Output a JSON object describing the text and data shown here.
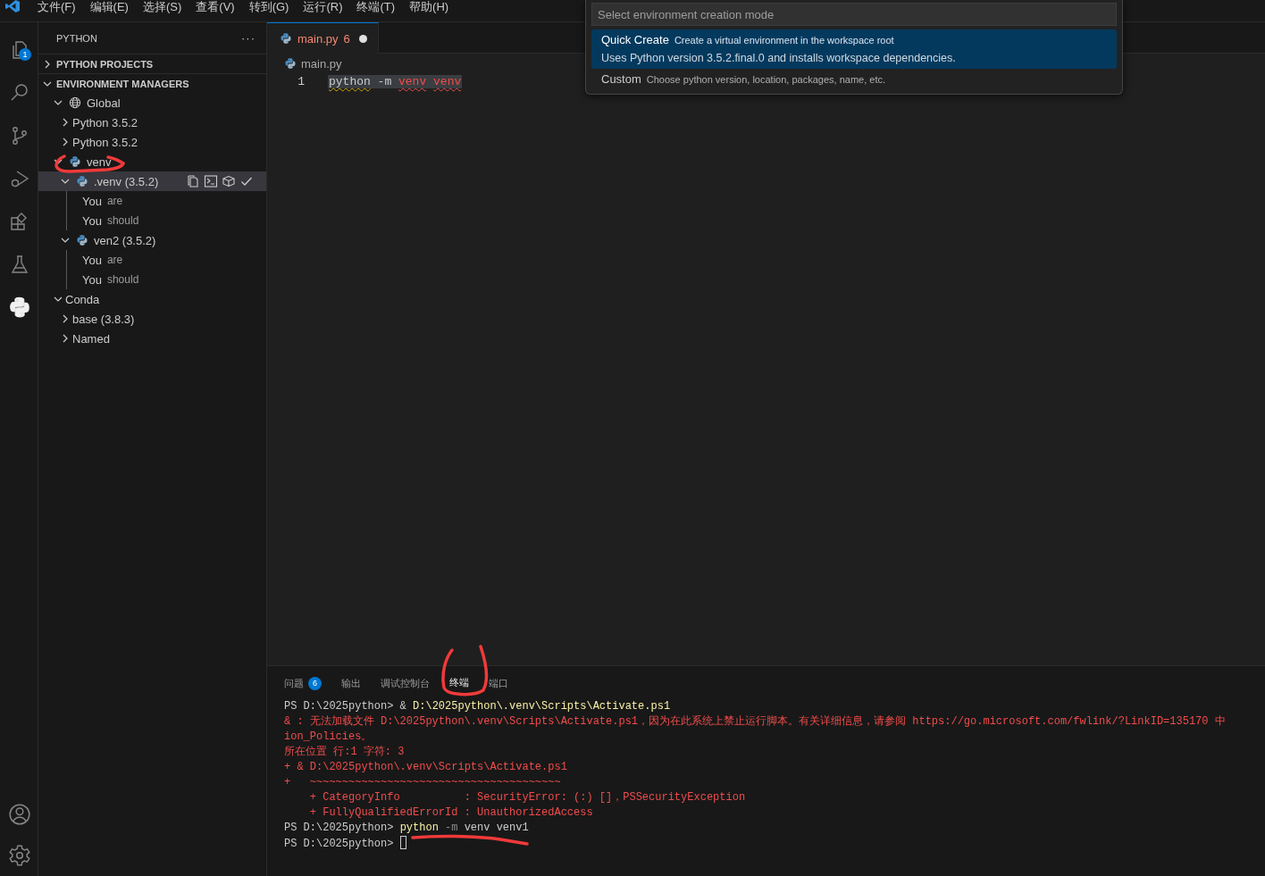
{
  "menu_bar": {
    "items": [
      "文件(F)",
      "编辑(E)",
      "选择(S)",
      "查看(V)",
      "转到(G)",
      "运行(R)",
      "终端(T)",
      "帮助(H)"
    ]
  },
  "activity_bar": {
    "items": [
      {
        "kind": "explorer",
        "selected": false,
        "badge": "1"
      },
      {
        "kind": "search",
        "selected": false
      },
      {
        "kind": "scm",
        "selected": false
      },
      {
        "kind": "debug",
        "selected": false
      },
      {
        "kind": "extensions",
        "selected": false
      },
      {
        "kind": "testing",
        "selected": false
      },
      {
        "kind": "python",
        "selected": true
      }
    ],
    "bottom": [
      {
        "kind": "account"
      },
      {
        "kind": "settings"
      }
    ]
  },
  "sidebar": {
    "title": "PYTHON",
    "more": "···",
    "sections": [
      {
        "title": "PYTHON PROJECTS",
        "expanded": false
      },
      {
        "title": "ENVIRONMENT MANAGERS",
        "expanded": true,
        "tree": [
          {
            "label": "Global",
            "kind": "scope",
            "expanded": true,
            "children": [
              {
                "label": "Python 3.5.2",
                "kind": "plain",
                "expanded": false
              },
              {
                "label": "Python 3.5.2",
                "kind": "plain",
                "expanded": false
              }
            ]
          },
          {
            "label": "venv",
            "kind": "environment",
            "expanded": true,
            "children": [
              {
                "label": ".venv (3.5.2)",
                "kind": "environment",
                "expanded": true,
                "selected": true,
                "children": [
                  {
                    "label": "You",
                    "description": "are"
                  },
                  {
                    "label": "You",
                    "description": "should"
                  }
                ]
              },
              {
                "label": "ven2 (3.5.2)",
                "kind": "environment",
                "expanded": true,
                "selected": false,
                "children": [
                  {
                    "label": "You",
                    "description": "are"
                  },
                  {
                    "label": "You",
                    "description": "should"
                  }
                ]
              }
            ]
          },
          {
            "label": "Conda",
            "kind": "plain",
            "expanded": true,
            "children": [
              {
                "label": "base (3.8.3)",
                "kind": "plain",
                "expanded": false
              },
              {
                "label": "Named",
                "kind": "plain",
                "expanded": false
              }
            ]
          }
        ]
      }
    ]
  },
  "editor": {
    "tabs": [
      {
        "label": "main.py",
        "problems": "6",
        "modified": true,
        "selected": true
      }
    ],
    "breadcrumb": "main.py",
    "lines": [
      {
        "number": "1",
        "selected": true,
        "tokens": [
          {
            "text": "python",
            "warning": true,
            "error": false
          },
          {
            "text": "-m",
            "warning": false,
            "error": false
          },
          {
            "text": "venv",
            "warning": false,
            "error": true
          },
          {
            "text": "venv",
            "warning": false,
            "error": true
          }
        ]
      }
    ]
  },
  "quick_pick": {
    "placeholder": "Select environment creation mode",
    "items": [
      {
        "label": "Quick Create",
        "description": "Create a virtual environment in the workspace root",
        "detail": "Uses Python version 3.5.2.final.0 and installs workspace dependencies.",
        "selected": true
      },
      {
        "label": "Custom",
        "description": "Choose python version, location, packages, name, etc.",
        "selected": false
      }
    ]
  },
  "panel": {
    "tabs": [
      {
        "label": "问题",
        "badge": "6",
        "selected": false
      },
      {
        "label": "输出",
        "selected": false
      },
      {
        "label": "调试控制台",
        "selected": false
      },
      {
        "label": "终端",
        "selected": true
      },
      {
        "label": "端口",
        "selected": false
      }
    ],
    "terminal": [
      [
        {
          "text": "PS D:\\2025python> & ",
          "kind": "plain"
        },
        {
          "text": "D:\\2025python\\.venv\\Scripts\\Activate.ps1",
          "kind": "command"
        }
      ],
      [
        {
          "text": "& : 无法加载文件 D:\\2025python\\.venv\\Scripts\\Activate.ps1，因为在此系统上禁止运行脚本。有关详细信息，请参阅 https://go.microsoft.com/fwlink/?LinkID=135170 中",
          "kind": "error"
        }
      ],
      [
        {
          "text": "ion_Policies。",
          "kind": "error"
        }
      ],
      [
        {
          "text": "所在位置 行:1 字符: 3",
          "kind": "error"
        }
      ],
      [
        {
          "text": "+ & D:\\2025python\\.venv\\Scripts\\Activate.ps1",
          "kind": "error"
        }
      ],
      [
        {
          "text": "+   ~~~~~~~~~~~~~~~~~~~~~~~~~~~~~~~~~~~~~~~",
          "kind": "error"
        }
      ],
      [
        {
          "text": "    + CategoryInfo          : SecurityError: (:) []，PSSecurityException",
          "kind": "error"
        }
      ],
      [
        {
          "text": "    + FullyQualifiedErrorId : UnauthorizedAccess",
          "kind": "error"
        }
      ],
      [
        {
          "text": "PS D:\\2025python> ",
          "kind": "plain"
        },
        {
          "text": "python",
          "kind": "command"
        },
        {
          "text": " -m",
          "kind": "param"
        },
        {
          "text": " venv venv1",
          "kind": "plain"
        }
      ],
      [
        {
          "text": "PS D:\\2025python> ",
          "kind": "plain"
        },
        {
          "kind": "cursor"
        }
      ]
    ]
  }
}
